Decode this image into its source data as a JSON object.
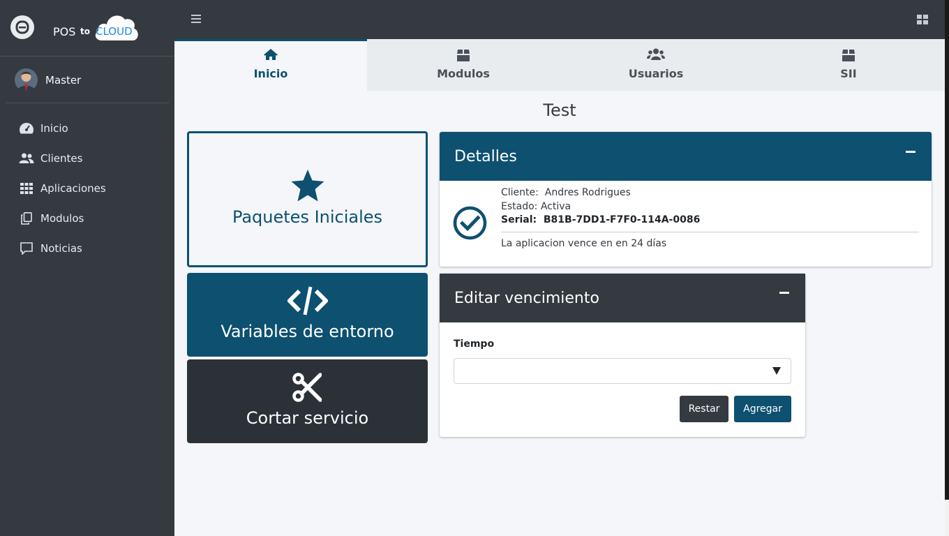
{
  "brand": {
    "pos": "POS",
    "to": "to",
    "cloud": "CLOUD"
  },
  "user": {
    "name": "Master"
  },
  "sidebar": {
    "items": [
      {
        "label": "Inicio",
        "icon": "tachometer-icon"
      },
      {
        "label": "Clientes",
        "icon": "users-icon"
      },
      {
        "label": "Aplicaciones",
        "icon": "grid-icon"
      },
      {
        "label": "Modulos",
        "icon": "copy-icon"
      },
      {
        "label": "Noticias",
        "icon": "comment-icon"
      }
    ]
  },
  "tabs": [
    {
      "label": "Inicio",
      "icon": "home-icon",
      "active": true
    },
    {
      "label": "Modulos",
      "icon": "box-icon",
      "active": false
    },
    {
      "label": "Usuarios",
      "icon": "users-icon",
      "active": false
    },
    {
      "label": "SII",
      "icon": "box-icon",
      "active": false
    }
  ],
  "page": {
    "title": "Test"
  },
  "tiles": {
    "packages": "Paquetes Iniciales",
    "env": "Variables de entorno",
    "cut": "Cortar servicio"
  },
  "details": {
    "title": "Detalles",
    "cliente_label": "Cliente:",
    "cliente": "Andres Rodrigues",
    "estado_label": "Estado:",
    "estado": "Activa",
    "serial_label": "Serial:",
    "serial": "B81B-7DD1-F7F0-114A-0086",
    "expiry": "La aplicacion vence en en 24 días"
  },
  "edit": {
    "title": "Editar vencimiento",
    "field_label": "Tiempo",
    "field_value": "",
    "reset_label": "Restar",
    "add_label": "Agregar"
  },
  "colors": {
    "primary": "#0d5070",
    "sidebar": "#343a40",
    "background": "#f4f6f9"
  }
}
